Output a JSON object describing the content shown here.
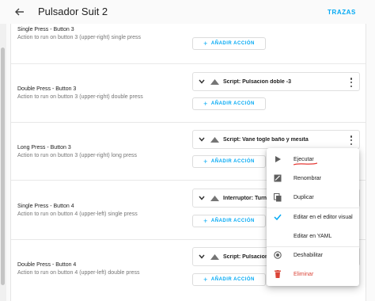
{
  "header": {
    "title": "Pulsador Suit 2",
    "trazas": "TRAZAS"
  },
  "rows": [
    {
      "title": "Single Press - Button 3",
      "desc": "Action to run on button 3 (upper-right) single press",
      "add_label": "AÑADIR ACCIÓN"
    },
    {
      "title": "Double Press - Button 3",
      "desc": "Action to run on button 3 (upper-right) double press",
      "action": "Script: Pulsacion doble -3",
      "add_label": "AÑADIR ACCIÓN"
    },
    {
      "title": "Long Press - Button 3",
      "desc": "Action to run on button 3 (upper-right) long press",
      "action": "Script: Vane togle baño y mesita",
      "add_label": "AÑADIR ACCIÓN"
    },
    {
      "title": "Single Press - Button 4",
      "desc": "Action to run on button 4 (upper-left) single press",
      "action": "Interruptor: Turn o",
      "add_label": "AÑADIR ACCIÓN"
    },
    {
      "title": "Double Press - Button 4",
      "desc": "Action to run on button 4 (upper-left) double press",
      "action": "Script: Pulsacion d",
      "add_label": "AÑADIR ACCIÓN"
    }
  ],
  "menu": {
    "items": [
      {
        "label": "Ejecutar",
        "icon": "play-icon"
      },
      {
        "label": "Renombrar",
        "icon": "rename-icon"
      },
      {
        "label": "Duplicar",
        "icon": "duplicate-icon"
      },
      {
        "label": "Editar en el editor visual",
        "icon": "check-icon"
      },
      {
        "label": "Editar en YAML",
        "icon": ""
      },
      {
        "label": "Deshabilitar",
        "icon": "disable-icon"
      },
      {
        "label": "Eliminar",
        "icon": "delete-icon"
      }
    ]
  },
  "colors": {
    "accent": "#03a9f4",
    "danger": "#db4437",
    "check": "#03a9f4"
  }
}
